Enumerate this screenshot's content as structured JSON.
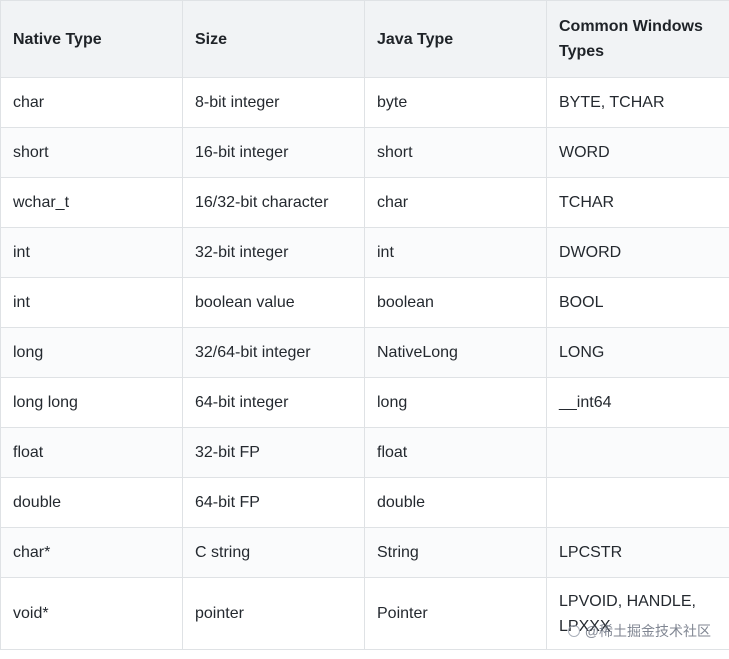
{
  "table": {
    "headers": [
      "Native Type",
      "Size",
      "Java Type",
      "Common Windows Types"
    ],
    "rows": [
      [
        "char",
        "8-bit integer",
        "byte",
        "BYTE, TCHAR"
      ],
      [
        "short",
        "16-bit integer",
        "short",
        "WORD"
      ],
      [
        "wchar_t",
        "16/32-bit character",
        "char",
        "TCHAR"
      ],
      [
        "int",
        "32-bit integer",
        "int",
        "DWORD"
      ],
      [
        "int",
        "boolean value",
        "boolean",
        "BOOL"
      ],
      [
        "long",
        "32/64-bit integer",
        "NativeLong",
        "LONG"
      ],
      [
        "long long",
        "64-bit integer",
        "long",
        "__int64"
      ],
      [
        "float",
        "32-bit FP",
        "float",
        ""
      ],
      [
        "double",
        "64-bit FP",
        "double",
        ""
      ],
      [
        "char*",
        "C string",
        "String",
        "LPCSTR"
      ],
      [
        "void*",
        "pointer",
        "Pointer",
        "LPVOID, HANDLE, LPXXX"
      ]
    ]
  },
  "watermark": {
    "text": "@稀土掘金技术社区",
    "icon": "sparkle-icon"
  }
}
